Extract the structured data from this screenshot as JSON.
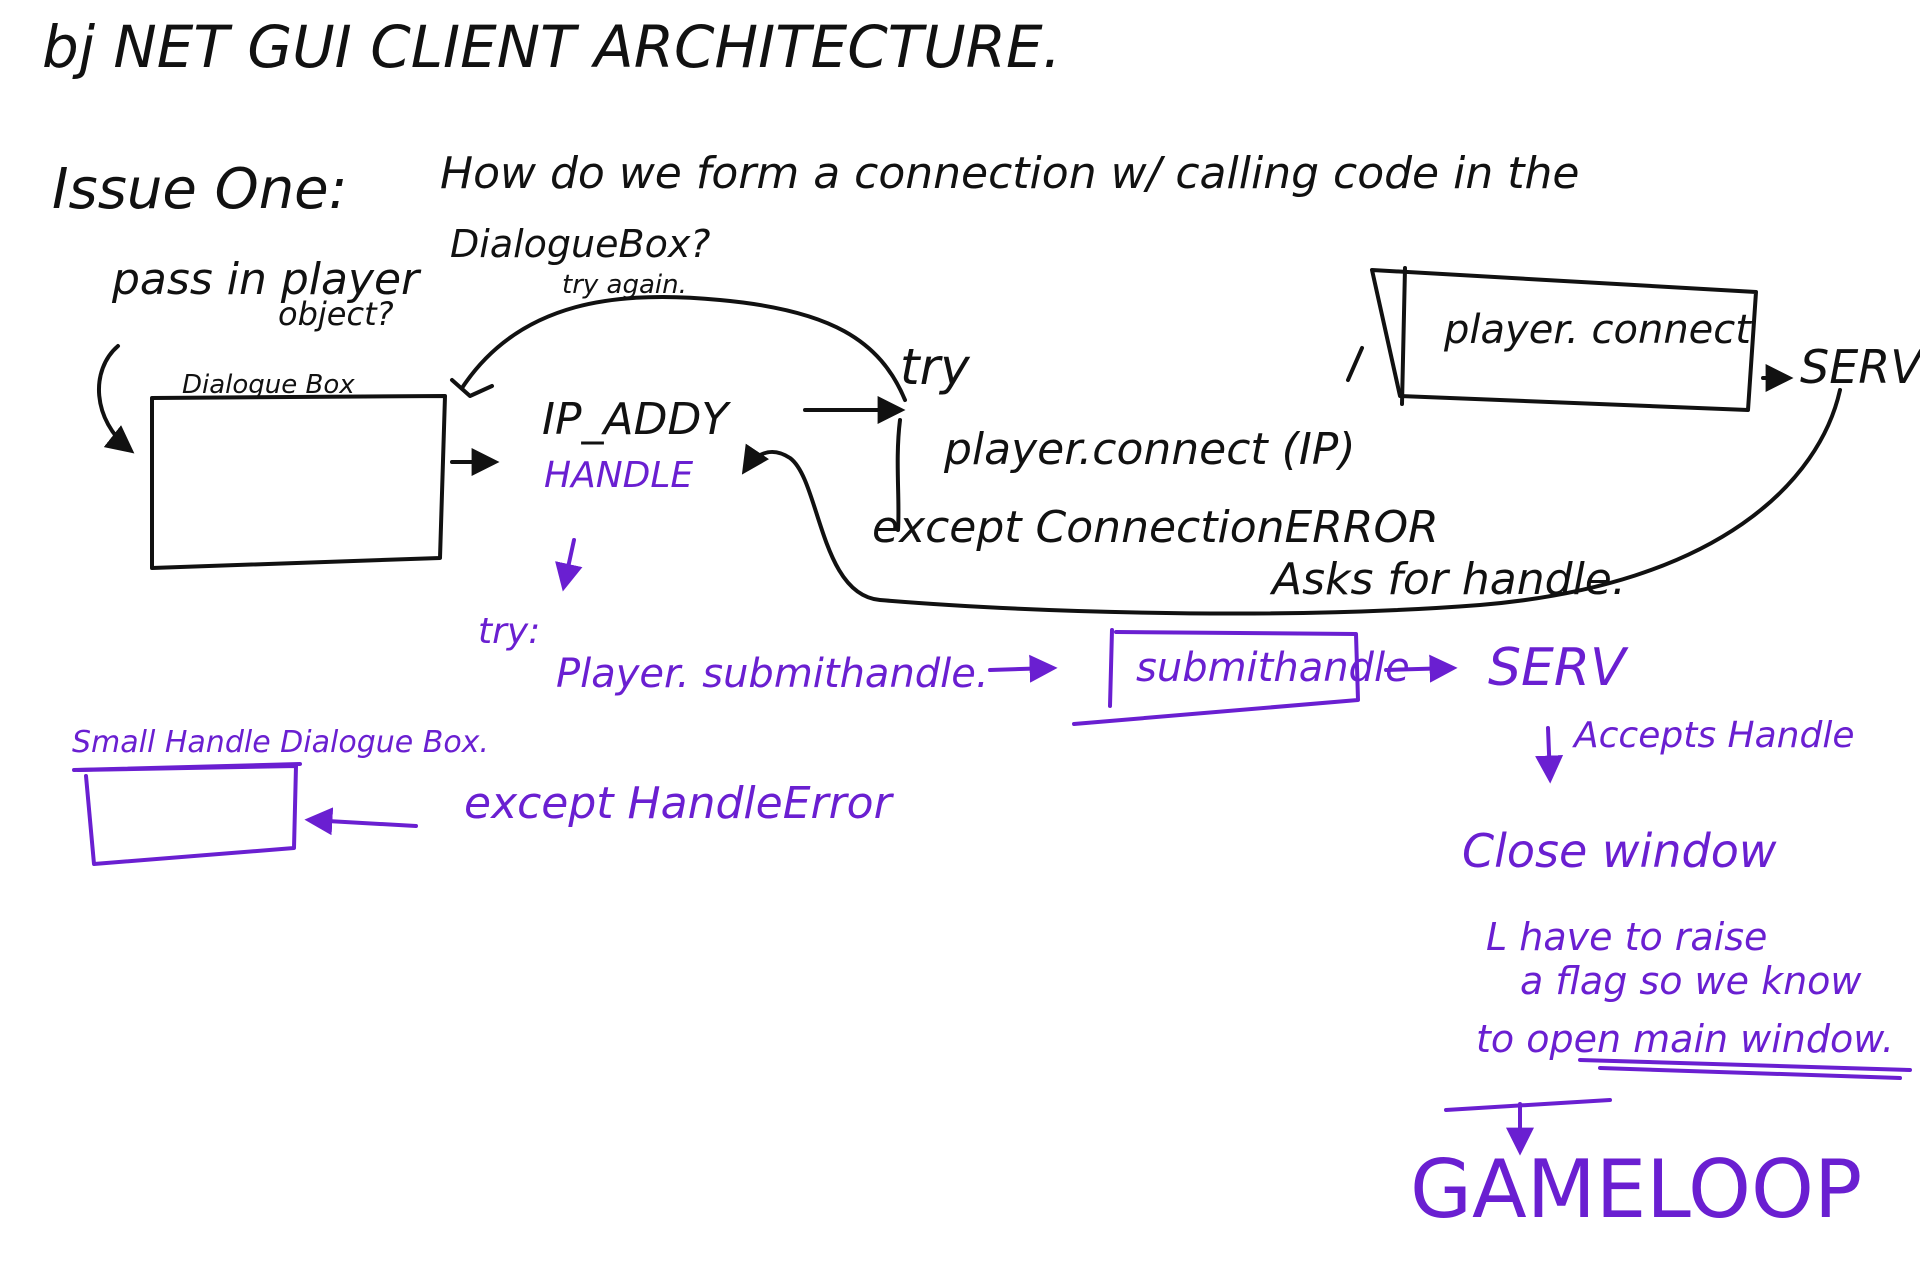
{
  "title": "bj NET GUI CLIENT ARCHITECTURE.",
  "issue": {
    "label": "Issue One:",
    "question_line1": "How do we form a connection w/ calling code in the",
    "question_line2": "DialogueBox?"
  },
  "notes": {
    "pass_in_player": "pass in player",
    "object": "object?",
    "try_again": "try again."
  },
  "nodes": {
    "dialogue_box": "Dialogue Box",
    "ip_addr": "IP_ADDY",
    "handle": "HANDLE",
    "try": "try",
    "player_connect_ip": "player.connect (IP)",
    "except_connection": "except ConnectionERROR",
    "player_connect_box": "player. connect",
    "serv_top": "SERV",
    "asks_for_handle": "Asks for handle.",
    "try_purple": "try:",
    "player_submit": "Player. submithandle.",
    "submit_box": "submithandle",
    "serv_bottom": "SERV",
    "accepts_handle": "Accepts Handle",
    "small_handle": "Small Handle Dialogue Box.",
    "except_handle": "except HandleError",
    "close_window": "Close window",
    "raise_flag_1": "L have to raise",
    "raise_flag_2": "a flag so we know",
    "raise_flag_3": "to open main window.",
    "game_loop": "GAMELOOP"
  },
  "colors": {
    "black_ink": "#111111",
    "purple_ink": "#6a1fd1"
  }
}
